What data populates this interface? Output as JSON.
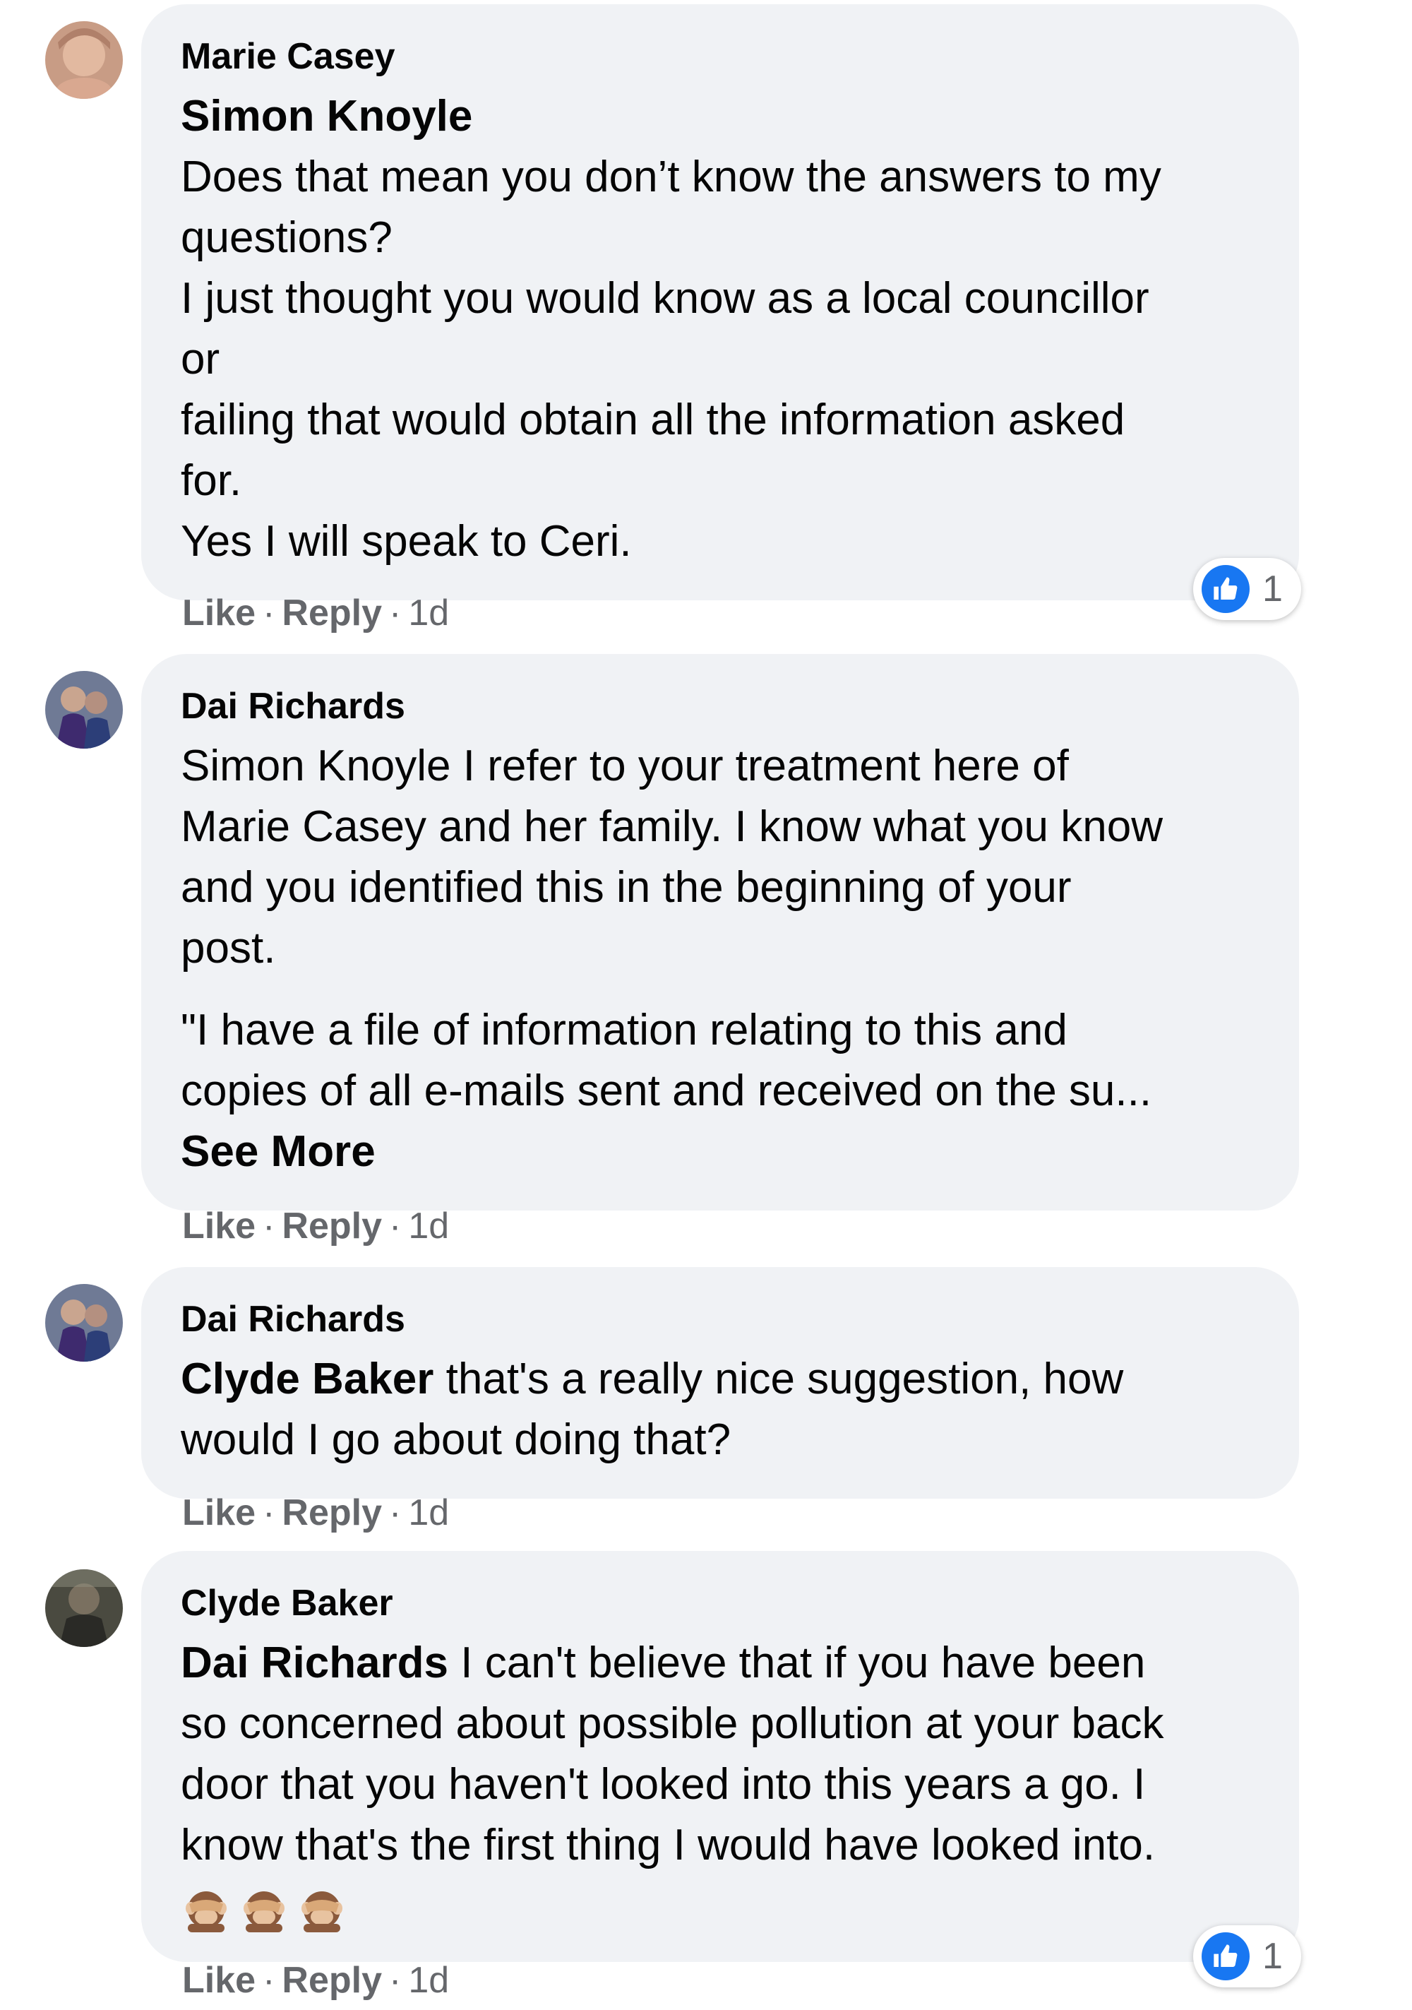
{
  "comments": [
    {
      "author": "Marie Casey",
      "mention": "Simon Knoyle",
      "lines": [
        "Does that mean you don’t know the answers to my",
        "questions?",
        "I just thought you would know as a local councillor",
        "or",
        "failing that would obtain all the information asked",
        "for.",
        "Yes I will speak to Ceri."
      ],
      "like_label": "Like",
      "reply_label": "Reply",
      "time": "1d",
      "reaction_count": "1"
    },
    {
      "author": "Dai Richards",
      "paragraph1": [
        "Simon Knoyle I refer to your treatment here of",
        "Marie Casey and her family. I know what you know",
        "and you identified this in the beginning of your",
        "post."
      ],
      "paragraph2": [
        "\"I have a file of information relating to this and",
        "copies of all e-mails sent and received on the su..."
      ],
      "see_more": "See More",
      "like_label": "Like",
      "reply_label": "Reply",
      "time": "1d"
    },
    {
      "author": "Dai Richards",
      "mention": "Clyde Baker",
      "line1_rest": " that's a really nice suggestion, how",
      "line2": "would I go about doing that?",
      "like_label": "Like",
      "reply_label": "Reply",
      "time": "1d"
    },
    {
      "author": "Clyde Baker",
      "mention": "Dai Richards",
      "line1_rest": " I can't believe that if you have been",
      "lines": [
        "so concerned about possible pollution at your back",
        "door that you haven't looked into this years a go. I",
        "know that's the first thing I would have looked into."
      ],
      "emojis": [
        "see-no-evil-monkey",
        "see-no-evil-monkey",
        "see-no-evil-monkey"
      ],
      "like_label": "Like",
      "reply_label": "Reply",
      "time": "1d",
      "reaction_count": "1"
    }
  ],
  "separator": "·",
  "colors": {
    "bubble": "#f0f2f5",
    "meta": "#65676b",
    "like_blue": "#1877f2"
  }
}
